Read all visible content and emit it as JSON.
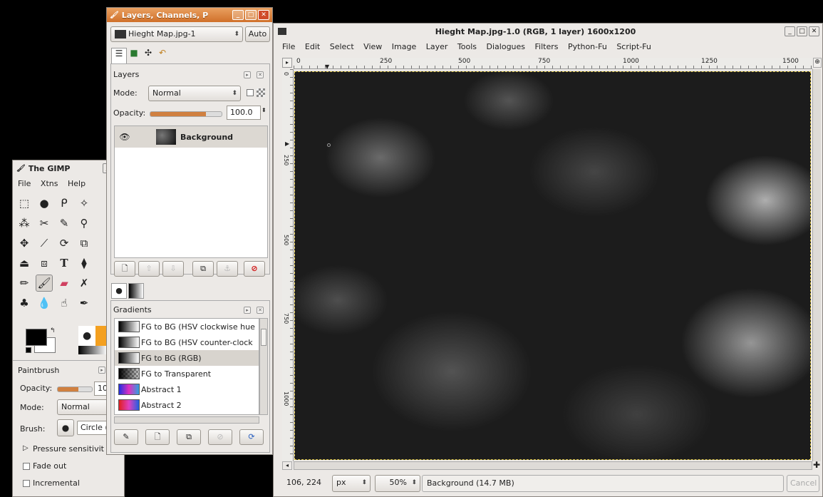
{
  "layers_window": {
    "title": "Layers, Channels, P",
    "image_select": "Hieght Map.jpg-1",
    "auto_label": "Auto",
    "layers_title": "Layers",
    "mode_label": "Mode:",
    "mode_value": "Normal",
    "opacity_label": "Opacity:",
    "opacity_value": "100.0",
    "layer_name": "Background",
    "gradients_title": "Gradients",
    "gradients": [
      {
        "name": "FG to BG (HSV clockwise hue",
        "selected": false
      },
      {
        "name": "FG to BG (HSV counter-clock",
        "selected": false
      },
      {
        "name": "FG to BG (RGB)",
        "selected": true
      },
      {
        "name": "FG to Transparent",
        "selected": false
      },
      {
        "name": "Abstract 1",
        "selected": false
      },
      {
        "name": "Abstract 2",
        "selected": false
      }
    ]
  },
  "toolbox": {
    "title": "The GIMP",
    "menu": [
      "File",
      "Xtns",
      "Help"
    ],
    "options_title": "Paintbrush",
    "opacity_label": "Opacity:",
    "opacity_value": "10",
    "mode_label": "Mode:",
    "mode_value": "Normal",
    "brush_label": "Brush:",
    "brush_value": "Circle (",
    "pressure_label": "Pressure sensitivit",
    "fade_label": "Fade out",
    "incremental_label": "Incremental"
  },
  "image_window": {
    "title": "Hieght Map.jpg-1.0 (RGB, 1 layer) 1600x1200",
    "menu": [
      "File",
      "Edit",
      "Select",
      "View",
      "Image",
      "Layer",
      "Tools",
      "Dialogues",
      "Filters",
      "Python-Fu",
      "Script-Fu"
    ],
    "ruler_labels": [
      "0",
      "250",
      "500",
      "750",
      "1000",
      "1250",
      "1500"
    ],
    "ruler_v_labels": [
      "0",
      "250",
      "500",
      "750",
      "1000"
    ],
    "coords": "106, 224",
    "unit": "px",
    "zoom": "50%",
    "status": "Background (14.7 MB)",
    "cancel_label": "Cancel"
  }
}
